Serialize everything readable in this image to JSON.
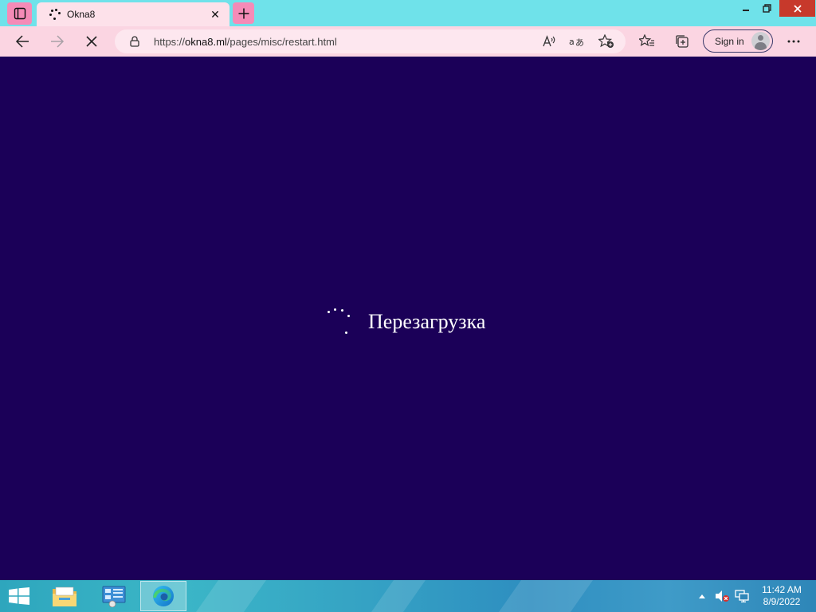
{
  "browser": {
    "tab": {
      "title": "Okna8",
      "close_glyph": "✕"
    },
    "address": {
      "scheme": "https://",
      "host": "okna8.ml",
      "path": "/pages/misc/restart.html"
    },
    "signin_label": "Sign in"
  },
  "page": {
    "background": "#1b0058",
    "status_text": "Перезагрузка"
  },
  "taskbar": {
    "apps": [
      "file-explorer",
      "control-panel",
      "microsoft-edge"
    ],
    "clock": {
      "time": "11:42 AM",
      "date": "8/9/2022"
    }
  },
  "colors": {
    "tabstrip": "#6fe2ea",
    "accent_pink": "#f58bb7",
    "toolbar": "#fbd5e2",
    "close_red": "#c7392b"
  }
}
